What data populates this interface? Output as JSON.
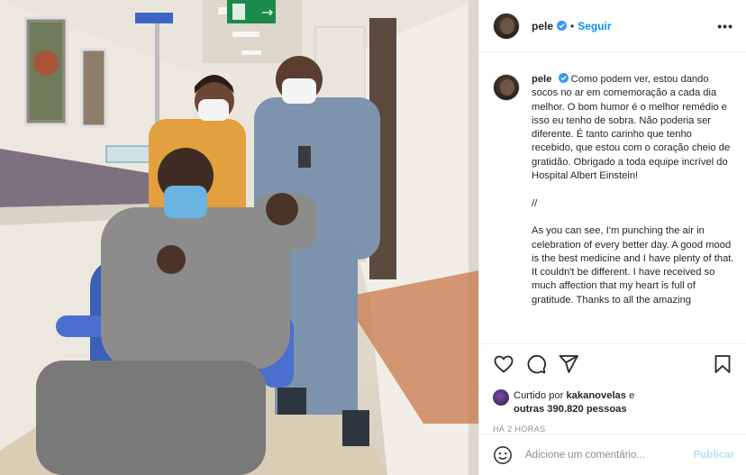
{
  "post": {
    "image_description_alt": "",
    "exit_sign_arrow": "→",
    "author": "pele",
    "verified_icon": "verified-badge-icon",
    "separator": "•",
    "follow_label": "Seguir",
    "more_label": "•••"
  },
  "caption": {
    "author": "pele",
    "text": "Como podem ver, estou dando socos no ar em comemoração a cada dia melhor. O bom humor é o melhor remédio e isso eu tenho de sobra. Não poderia ser diferente. É tanto carinho que tenho recebido, que estou com o coração cheio de gratidão. Obrigado a toda equipe incrível do Hospital Albert Einstein!\n\n//\n\nAs you can see, I'm punching the air in celebration of every better day. A good mood is the best medicine and I have plenty of that. It couldn't be different. I have received so much affection that my heart is full of gratitude. Thanks to all the amazing"
  },
  "actions": {
    "like_icon": "heart-icon",
    "comment_icon": "comment-icon",
    "share_icon": "share-icon",
    "save_icon": "bookmark-icon"
  },
  "likes": {
    "prefix": "Curtido por ",
    "user": "kakanovelas",
    "middle": " e",
    "others": "outras 390.820 pessoas"
  },
  "timestamp": "HÁ 2 HORAS",
  "comment_box": {
    "emoji_icon": "emoji-icon",
    "placeholder": "Adicione um comentário...",
    "publish_label": "Publicar"
  },
  "colors": {
    "link": "#0095f6",
    "publish_disabled": "#b2dffc",
    "muted": "#8e8e8e"
  }
}
